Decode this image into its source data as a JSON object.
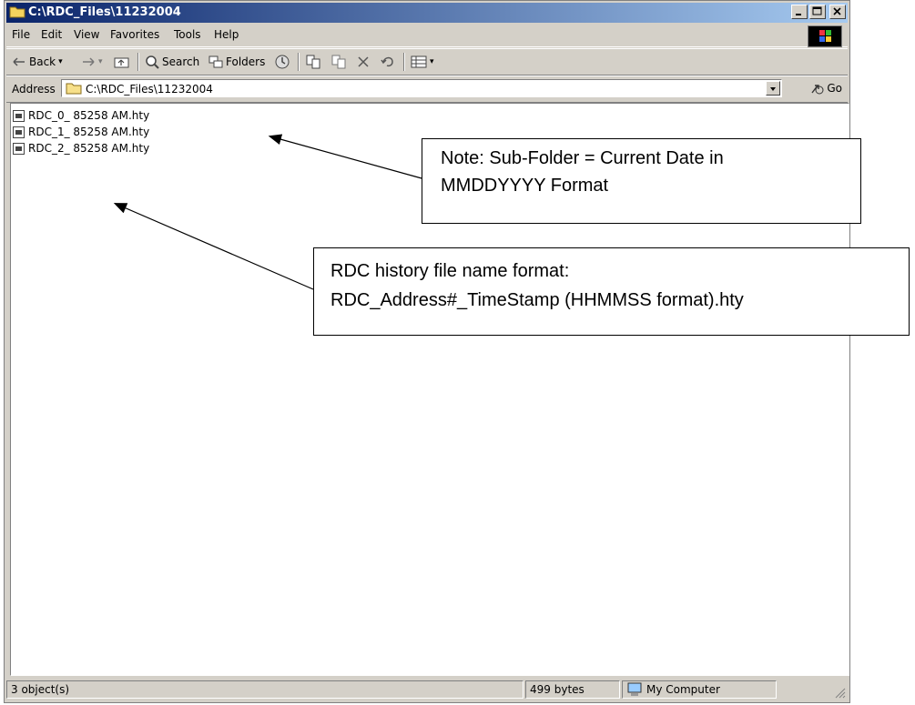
{
  "window": {
    "title": "C:\\RDC_Files\\11232004"
  },
  "menu": {
    "items": [
      "File",
      "Edit",
      "View",
      "Favorites",
      "Tools",
      "Help"
    ]
  },
  "toolbar": {
    "back_label": "Back",
    "search_label": "Search",
    "folders_label": "Folders"
  },
  "address": {
    "label": "Address",
    "value": "C:\\RDC_Files\\11232004",
    "go_label": "Go"
  },
  "files": [
    {
      "name": "RDC_0_ 85258 AM.hty"
    },
    {
      "name": "RDC_1_ 85258 AM.hty"
    },
    {
      "name": "RDC_2_ 85258 AM.hty"
    }
  ],
  "status": {
    "objects": "3 object(s)",
    "size": "499 bytes",
    "zone": "My Computer"
  },
  "annotations": {
    "note1_line1": "Note: Sub-Folder  = Current Date in",
    "note1_line2": "MMDDYYYY Format",
    "note2_line1": "RDC history file name format:",
    "note2_line2": "RDC_Address#_TimeStamp (HHMMSS format).hty"
  },
  "colors": {
    "title_gradient_start": "#0a246a",
    "title_gradient_end": "#a6caf0",
    "chrome": "#d4d0c8"
  },
  "icons": [
    "folder-icon",
    "minimize-icon",
    "maximize-icon",
    "close-icon",
    "windows-logo-icon",
    "back-arrow-icon",
    "forward-arrow-icon",
    "up-folder-icon",
    "search-icon",
    "folders-icon",
    "history-icon",
    "move-to-icon",
    "copy-to-icon",
    "delete-icon",
    "undo-icon",
    "views-icon",
    "go-icon",
    "document-icon",
    "computer-icon"
  ]
}
